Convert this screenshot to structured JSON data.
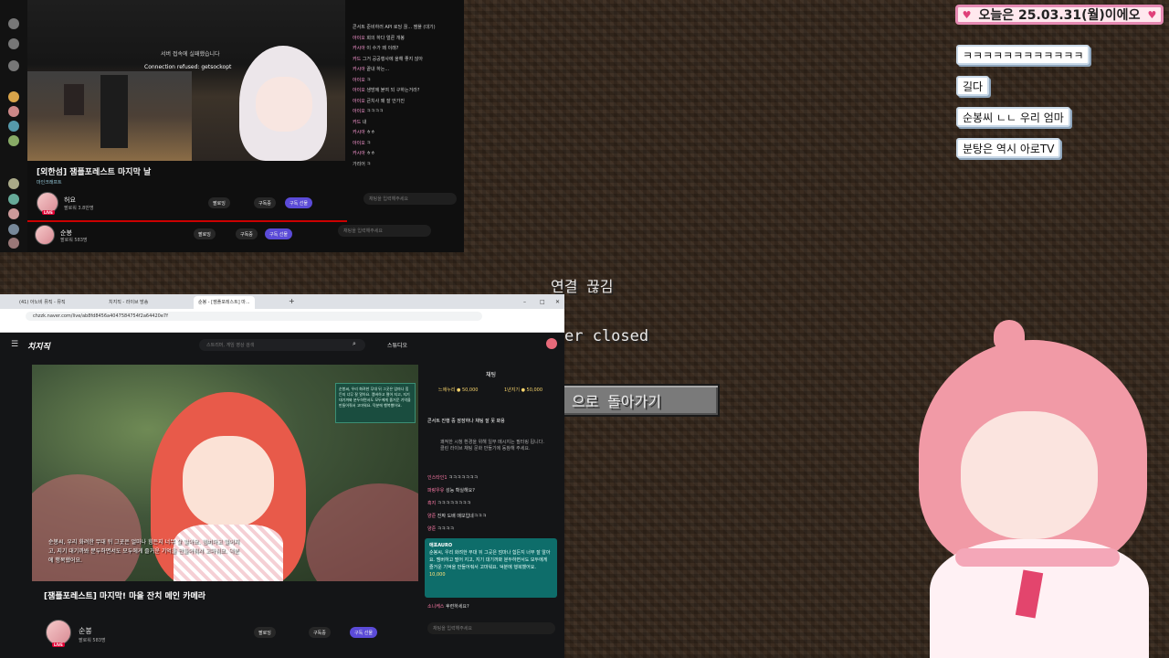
{
  "minecraft": {
    "disconnected_title": "연결 끊김",
    "closed_text": "er closed",
    "back_button": "으로 돌아가기"
  },
  "overlays": {
    "date_banner": "오늘은 25.03.31(월)이에오",
    "bubbles": [
      "ㅋㅋㅋㅋㅋㅋㅋㅋㅋㅋㅋㅋ",
      "길다",
      "순봉씨 ㄴㄴ 우리 엄마",
      "분탕은 역시 아로TV"
    ]
  },
  "top_window": {
    "video_text_1": "서버 접속에 실패했습니다",
    "video_text_2": "Connection refused: getsockopt",
    "title": "[외한섬] 잼플포레스트 마지막 날",
    "channel1": {
      "name": "허요",
      "sub": "팔로워 3.8만명",
      "live": "LIVE"
    },
    "channel2": {
      "name": "순봉",
      "sub": "팔로워 583명",
      "live": "LIVE"
    },
    "follow": "팔로잉",
    "subscribe": "구독중",
    "sub_btn": "구독 선물",
    "chat_placeholder": "채팅을 입력해주세요",
    "chat_lines": [
      {
        "nm": "",
        "msg": "콘서트 준비하러 API 로딩 끊... 잼플 (대기)"
      },
      {
        "nm": "아이오",
        "msg": "회의 하다 얼른 개봉"
      },
      {
        "nm": "카시아",
        "msg": "이 수가 왜 이래?"
      },
      {
        "nm": "카드",
        "msg": "그거 공공행사에 올해 좋지 않아"
      },
      {
        "nm": "카시아",
        "msg": "끝내 하는..."
      },
      {
        "nm": "아이오",
        "msg": "ㅋ"
      },
      {
        "nm": "아이오",
        "msg": "생방에 붙여 되 구하는거라?"
      },
      {
        "nm": "아이오",
        "msg": "큰치사 왜 잘 안가진"
      },
      {
        "nm": "아이오",
        "msg": "ㅋㅋㅋㅋ"
      },
      {
        "nm": "카드",
        "msg": "내"
      },
      {
        "nm": "카시아",
        "msg": "ㅎㅎ"
      },
      {
        "nm": "아이오",
        "msg": "ㅋ"
      },
      {
        "nm": "카시아",
        "msg": "ㅎㅎ"
      },
      {
        "nm": "",
        "msg": "가리어 ㅋ"
      }
    ]
  },
  "bottom_window": {
    "tabs": [
      "(41) 아노비 뮤직 - 뮤직",
      "치지직 - 라이브 방송",
      "순봉 - [잼플포레스트] 마..."
    ],
    "url": "chzzk.naver.com/live/ab8fd8456a4047584754f2a64420e7f",
    "logo": "치지직",
    "search_placeholder": "스트리머, 게임 영상 검색",
    "studio": "스튜디오",
    "chat_header": "채팅",
    "rank1": "느애누리 ● 50,000",
    "rank2": "1년지기 ● 50,000",
    "pinned": "콘서트 진행 중 잠잠하나 채팅 잘 못 봐용",
    "notice": "쾌적한 시청 환경을 위해 일부 메시지는 필터링 됩니다. 클린 라이브 채팅 문화 만들기에 동참해 주세요.",
    "chat_lines": [
      {
        "nm": "인스타인1",
        "msg": "ㅋㅋㅋㅋㅋㅋㅋ"
      },
      {
        "nm": "파랑우유",
        "msg": "성능 확실해요?"
      },
      {
        "nm": "흑지",
        "msg": "ㅋㅋㅋㅋㅋㅋㅋㅋ"
      },
      {
        "nm": "양준",
        "msg": "진짜 도배 매보입네ㅋㅋㅋ"
      },
      {
        "nm": "양준",
        "msg": "ㅋㅋㅋㅋ"
      }
    ],
    "mission_name": "애포AURO",
    "mission_text": "순봉씨, 우리 화려한 무대 뒤 그곳은 엄마나 힘든지 너무 잘 알아요. 멤버하고 떨어 지고, 지기 대기까봐 분두하면서도 모두에게 즐거운 기억을 만들어줘서 고마워요. 덕분에 행복했어요.",
    "mission_amount": "10,000",
    "last_chat": {
      "nm": "소니케스",
      "msg": "후련하세요?"
    },
    "chat_placeholder": "채팅을 입력해주세요",
    "title": "[잼플포레스트] 마지막! 마을 잔치 메인 카메라",
    "channel": {
      "name": "순봉",
      "sub": "팔로워 583명",
      "live": "LIVE"
    },
    "follow": "팔로잉",
    "subscribe": "구독중",
    "sub_btn": "구독 선물",
    "cap_text": "순봉씨, 우리 화려한 무대 뒤 그곳은 얼마나 힘든지 너무 잘 알아요. 멤버하고 떨어지고, 지기 대기까봐 분두하면서도 모두에게 즐거운 기억을 만들어줘서 고마워요. 덕분에 행복했어요."
  }
}
